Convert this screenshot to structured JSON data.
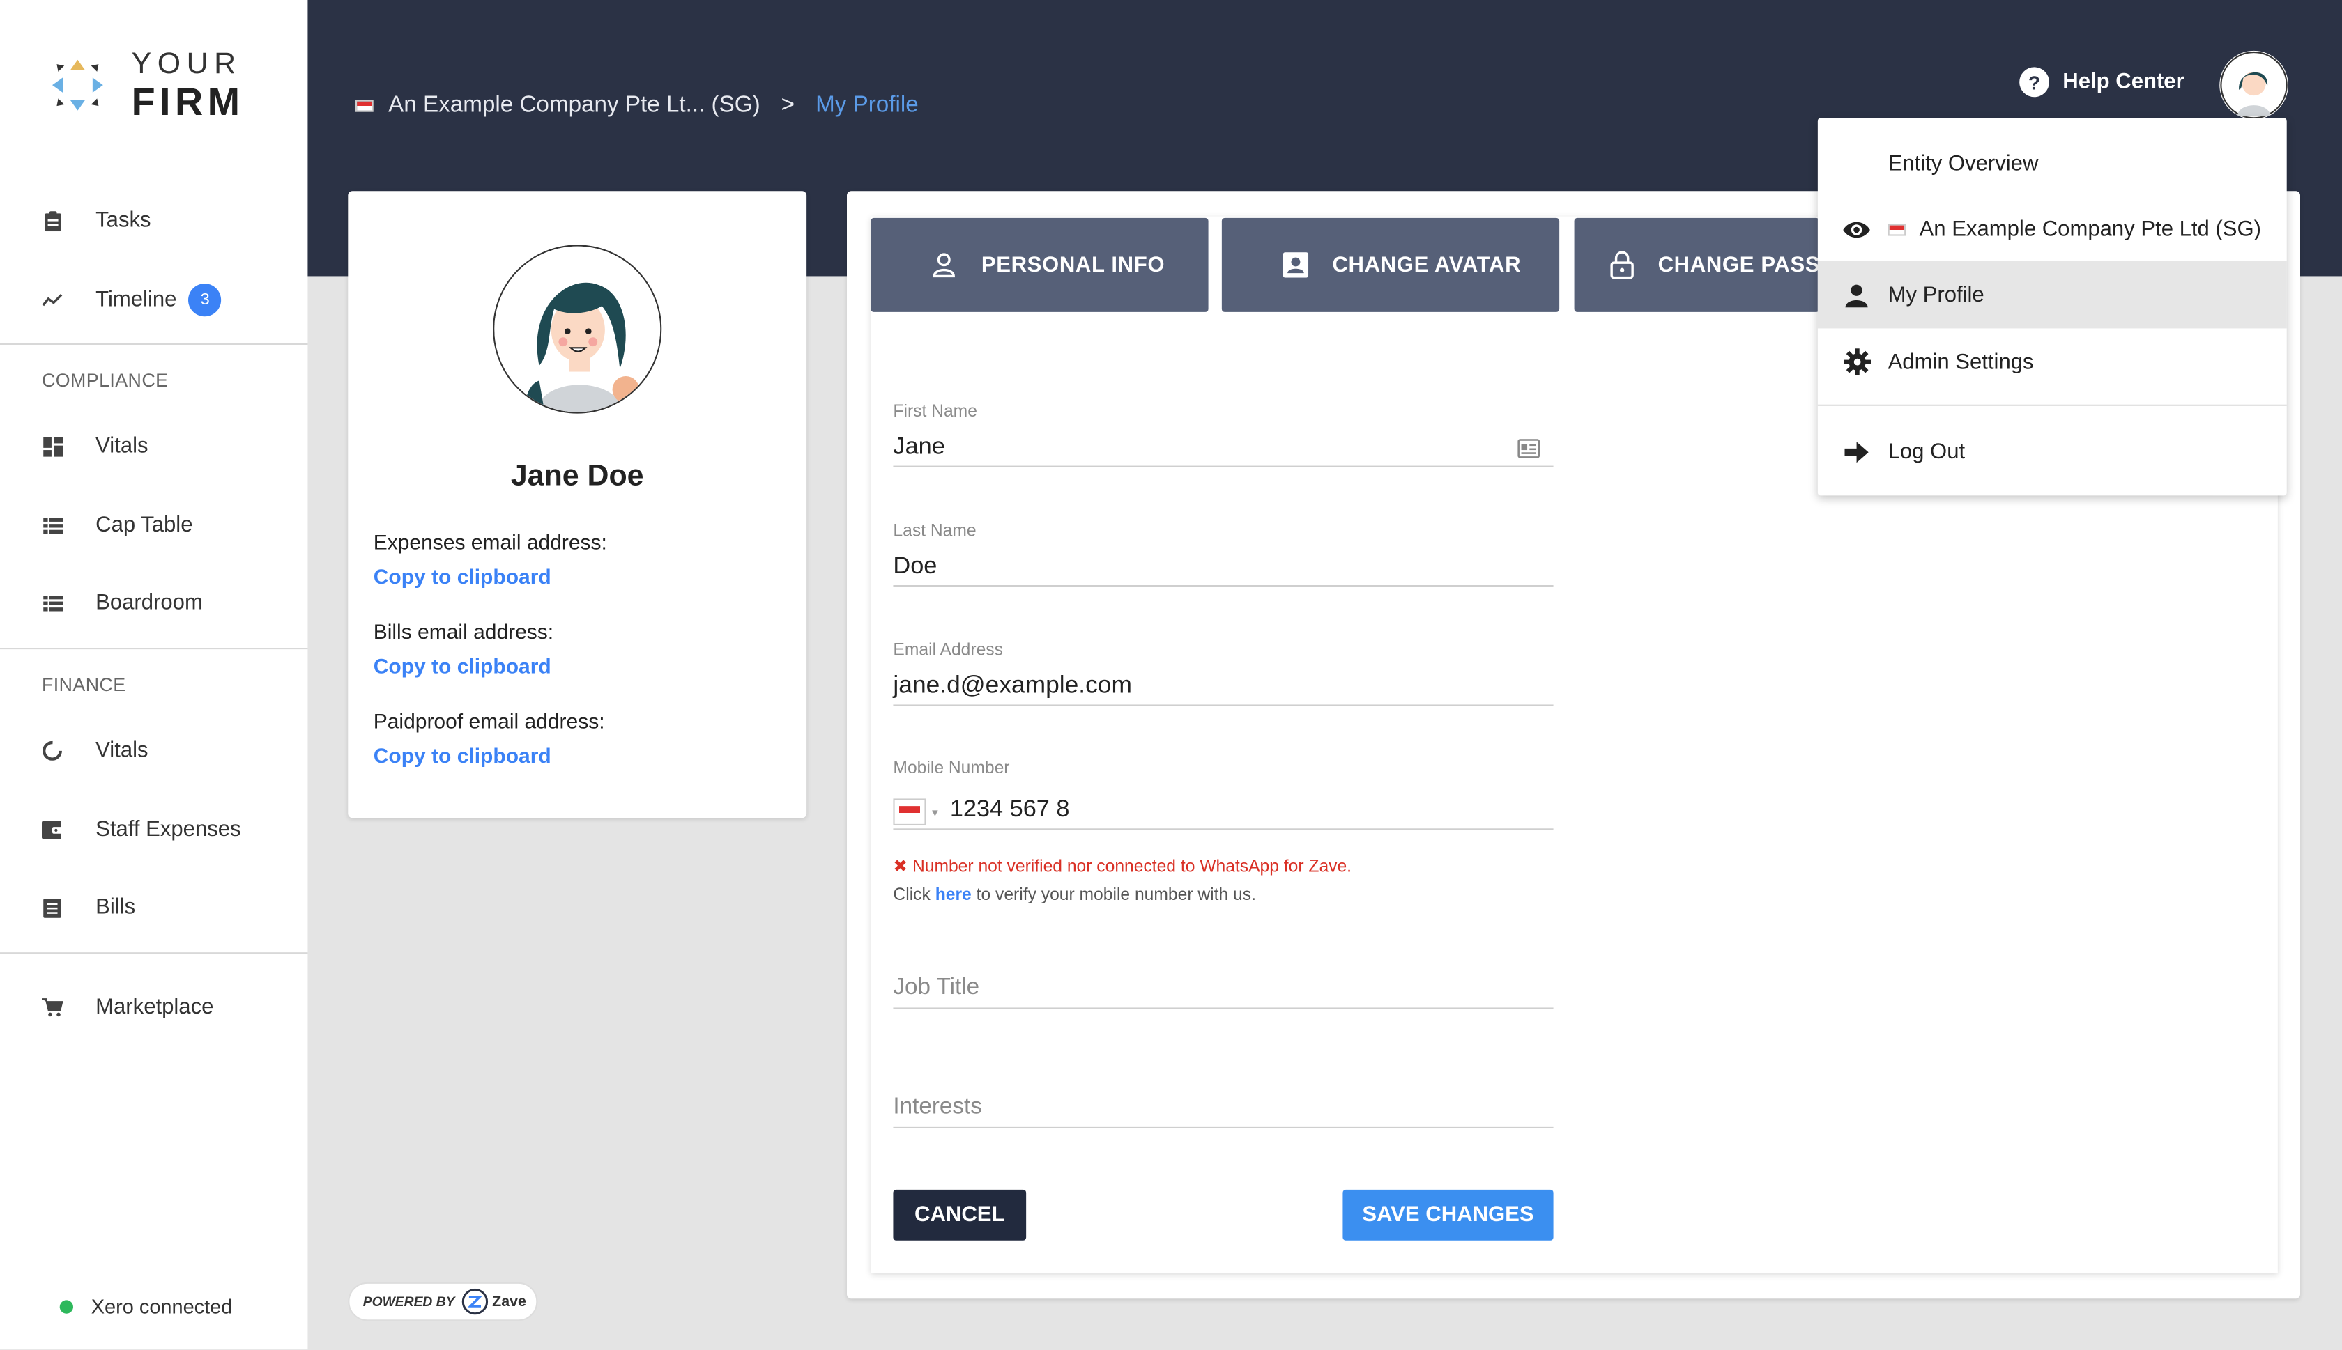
{
  "app": {
    "logo_line1": "YOUR",
    "logo_line2": "FIRM"
  },
  "sidebar": {
    "items_top": [
      {
        "label": "Tasks",
        "icon": "clipboard-icon"
      },
      {
        "label": "Timeline",
        "icon": "trend-icon",
        "badge": "3"
      }
    ],
    "compliance_label": "COMPLIANCE",
    "compliance_items": [
      {
        "label": "Vitals",
        "icon": "dashboard-icon"
      },
      {
        "label": "Cap Table",
        "icon": "list-icon"
      },
      {
        "label": "Boardroom",
        "icon": "list-icon"
      }
    ],
    "finance_label": "FINANCE",
    "finance_items": [
      {
        "label": "Vitals",
        "icon": "donut-icon"
      },
      {
        "label": "Staff Expenses",
        "icon": "wallet-icon"
      },
      {
        "label": "Bills",
        "icon": "receipt-icon"
      }
    ],
    "marketplace": {
      "label": "Marketplace",
      "icon": "cart-icon"
    },
    "xero_status": "Xero connected"
  },
  "header": {
    "breadcrumb_company": "An Example Company Pte Lt... (SG)",
    "breadcrumb_sep": ">",
    "breadcrumb_current": "My Profile",
    "help_label": "Help Center"
  },
  "profile": {
    "name": "Jane Doe",
    "expenses_label": "Expenses email address:",
    "bills_label": "Bills email address:",
    "paidproof_label": "Paidproof email address:",
    "copy_label": "Copy to clipboard"
  },
  "tabs": [
    {
      "label": "PERSONAL INFO",
      "icon": "person-outline-icon"
    },
    {
      "label": "CHANGE AVATAR",
      "icon": "portrait-icon"
    },
    {
      "label": "CHANGE PASSW",
      "icon": "lock-icon"
    }
  ],
  "form": {
    "first_name_label": "First Name",
    "first_name_value": "Jane",
    "last_name_label": "Last Name",
    "last_name_value": "Doe",
    "email_label": "Email Address",
    "email_value": "jane.d@example.com",
    "mobile_label": "Mobile Number",
    "mobile_value": "1234 567 8",
    "error_text": "Number not verified nor connected to WhatsApp for Zave.",
    "verify_prefix": "Click",
    "verify_link": "here",
    "verify_suffix": "to verify your mobile number with us.",
    "job_title_placeholder": "Job Title",
    "interests_placeholder": "Interests",
    "cancel_label": "CANCEL",
    "save_label": "SAVE CHANGES"
  },
  "powered": {
    "text": "POWERED BY",
    "brand": "Zave"
  },
  "dropdown": {
    "items": [
      {
        "label": "Entity Overview",
        "icon": ""
      },
      {
        "label": "An Example Company Pte Ltd (SG)",
        "icon": "eye-icon"
      },
      {
        "label": "My Profile",
        "icon": "person-icon"
      },
      {
        "label": "Admin Settings",
        "icon": "gear-icon"
      },
      {
        "label": "Log Out",
        "icon": "arrow-right-icon"
      }
    ]
  },
  "colors": {
    "header_bg": "#2b3245",
    "tab_bg": "#566078",
    "accent": "#3b82f6",
    "error": "#d93025",
    "xero_green": "#2eb85c"
  }
}
